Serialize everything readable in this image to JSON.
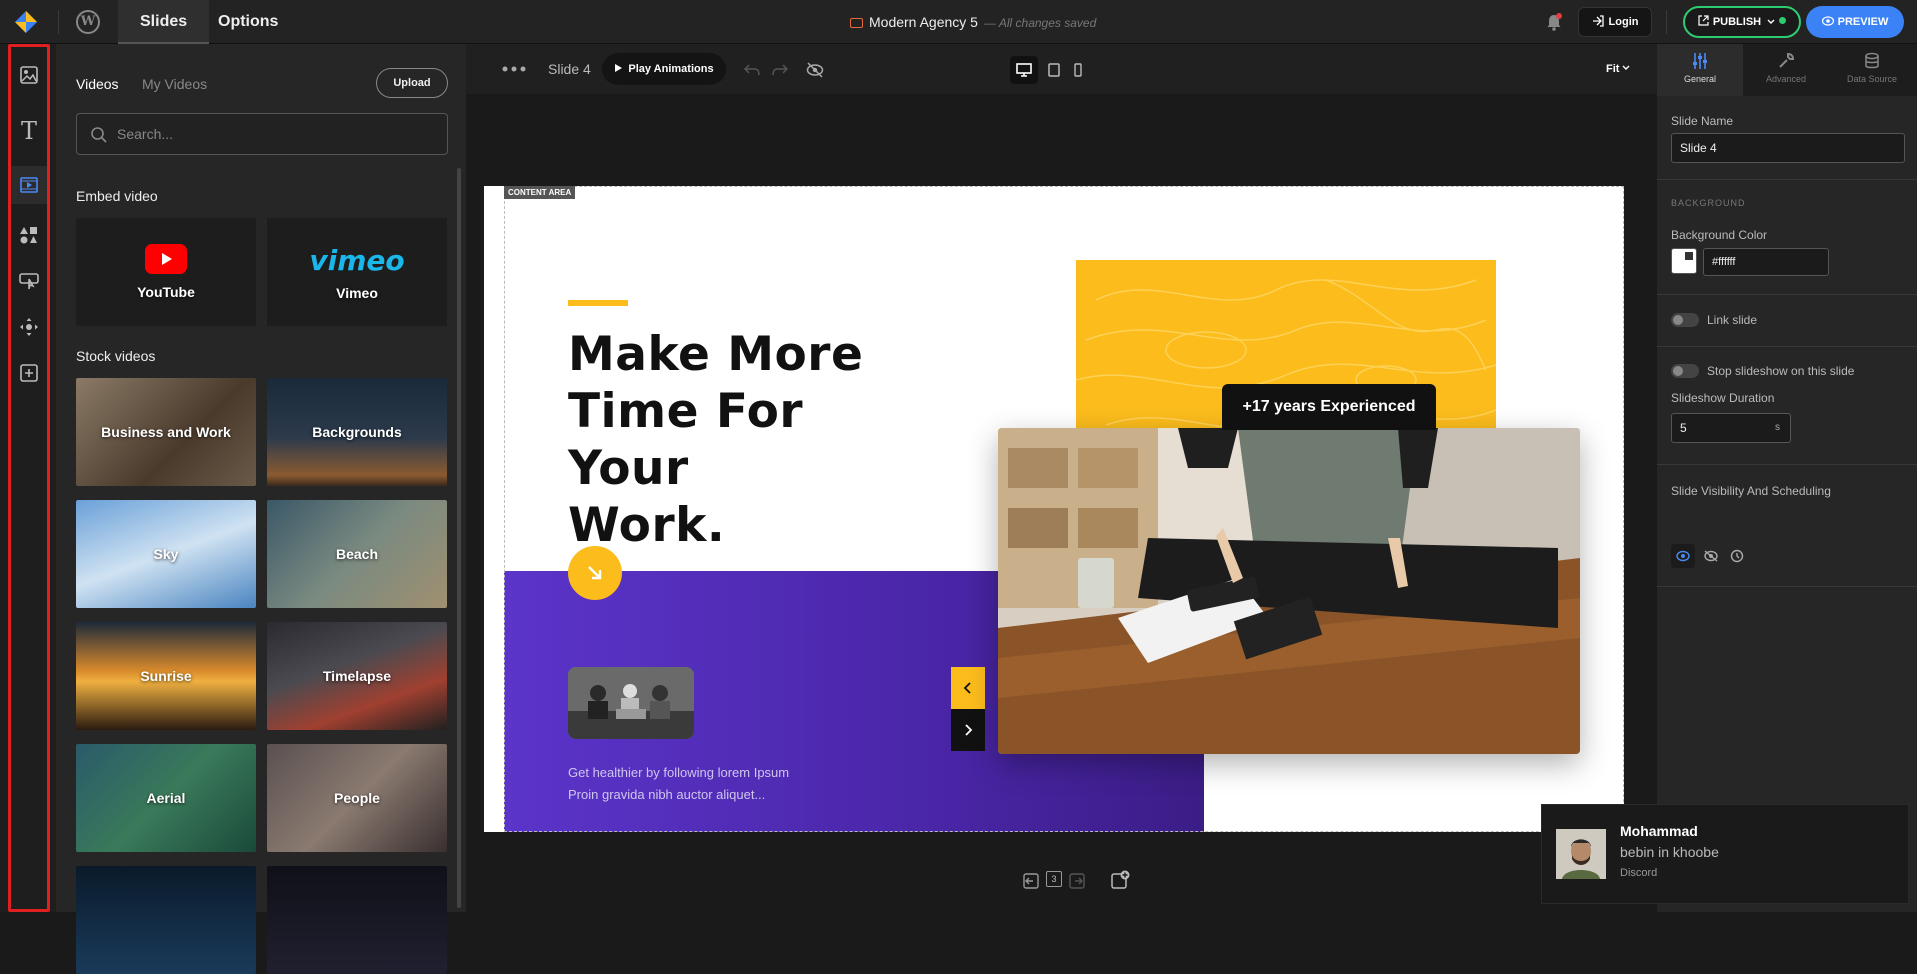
{
  "topbar": {
    "tabs": [
      "Slides",
      "Options"
    ],
    "doc_title": "Modern Agency 5",
    "save_status": "— All changes saved",
    "login_label": "Login",
    "publish_label": "PUBLISH",
    "preview_label": "PREVIEW"
  },
  "left_panel": {
    "tabs": [
      "Videos",
      "My Videos"
    ],
    "upload_label": "Upload",
    "search_placeholder": "Search...",
    "embed_title": "Embed video",
    "embed": [
      "YouTube",
      "Vimeo"
    ],
    "vimeo_logo": "vimeo",
    "stock_title": "Stock videos",
    "stock": [
      "Business and Work",
      "Backgrounds",
      "Sky",
      "Beach",
      "Sunrise",
      "Timelapse",
      "Aerial",
      "People"
    ]
  },
  "canvas": {
    "slide_label": "Slide 4",
    "play_label": "Play Animations",
    "fit_label": "Fit",
    "content_area_label": "CONTENT AREA",
    "headline": [
      "Make More",
      "Time For Your",
      "Work."
    ],
    "badge": "+17 years Experienced",
    "body_lines": [
      "Get healthier by following lorem Ipsum",
      "Proin gravida nibh auctor aliquet..."
    ],
    "slide_count": "3"
  },
  "right_panel": {
    "tabs": [
      "General",
      "Advanced",
      "Data Source"
    ],
    "slide_name_label": "Slide Name",
    "slide_name_value": "Slide 4",
    "background_section": "BACKGROUND",
    "bg_color_label": "Background Color",
    "bg_color_value": "#ffffff",
    "link_slide_label": "Link slide",
    "stop_slideshow_label": "Stop slideshow on this slide",
    "duration_label": "Slideshow Duration",
    "duration_value": "5",
    "duration_unit": "s",
    "visibility_label": "Slide Visibility And Scheduling"
  },
  "toast": {
    "name": "Mohammad",
    "message": "bebin in khoobe",
    "source": "Discord"
  },
  "colors": {
    "accent_yellow": "#fbbc1c",
    "accent_purple": "#5b34c9",
    "publish_green": "#2ecc71",
    "preview_blue": "#3b82f6",
    "highlight_red": "#e02020"
  }
}
